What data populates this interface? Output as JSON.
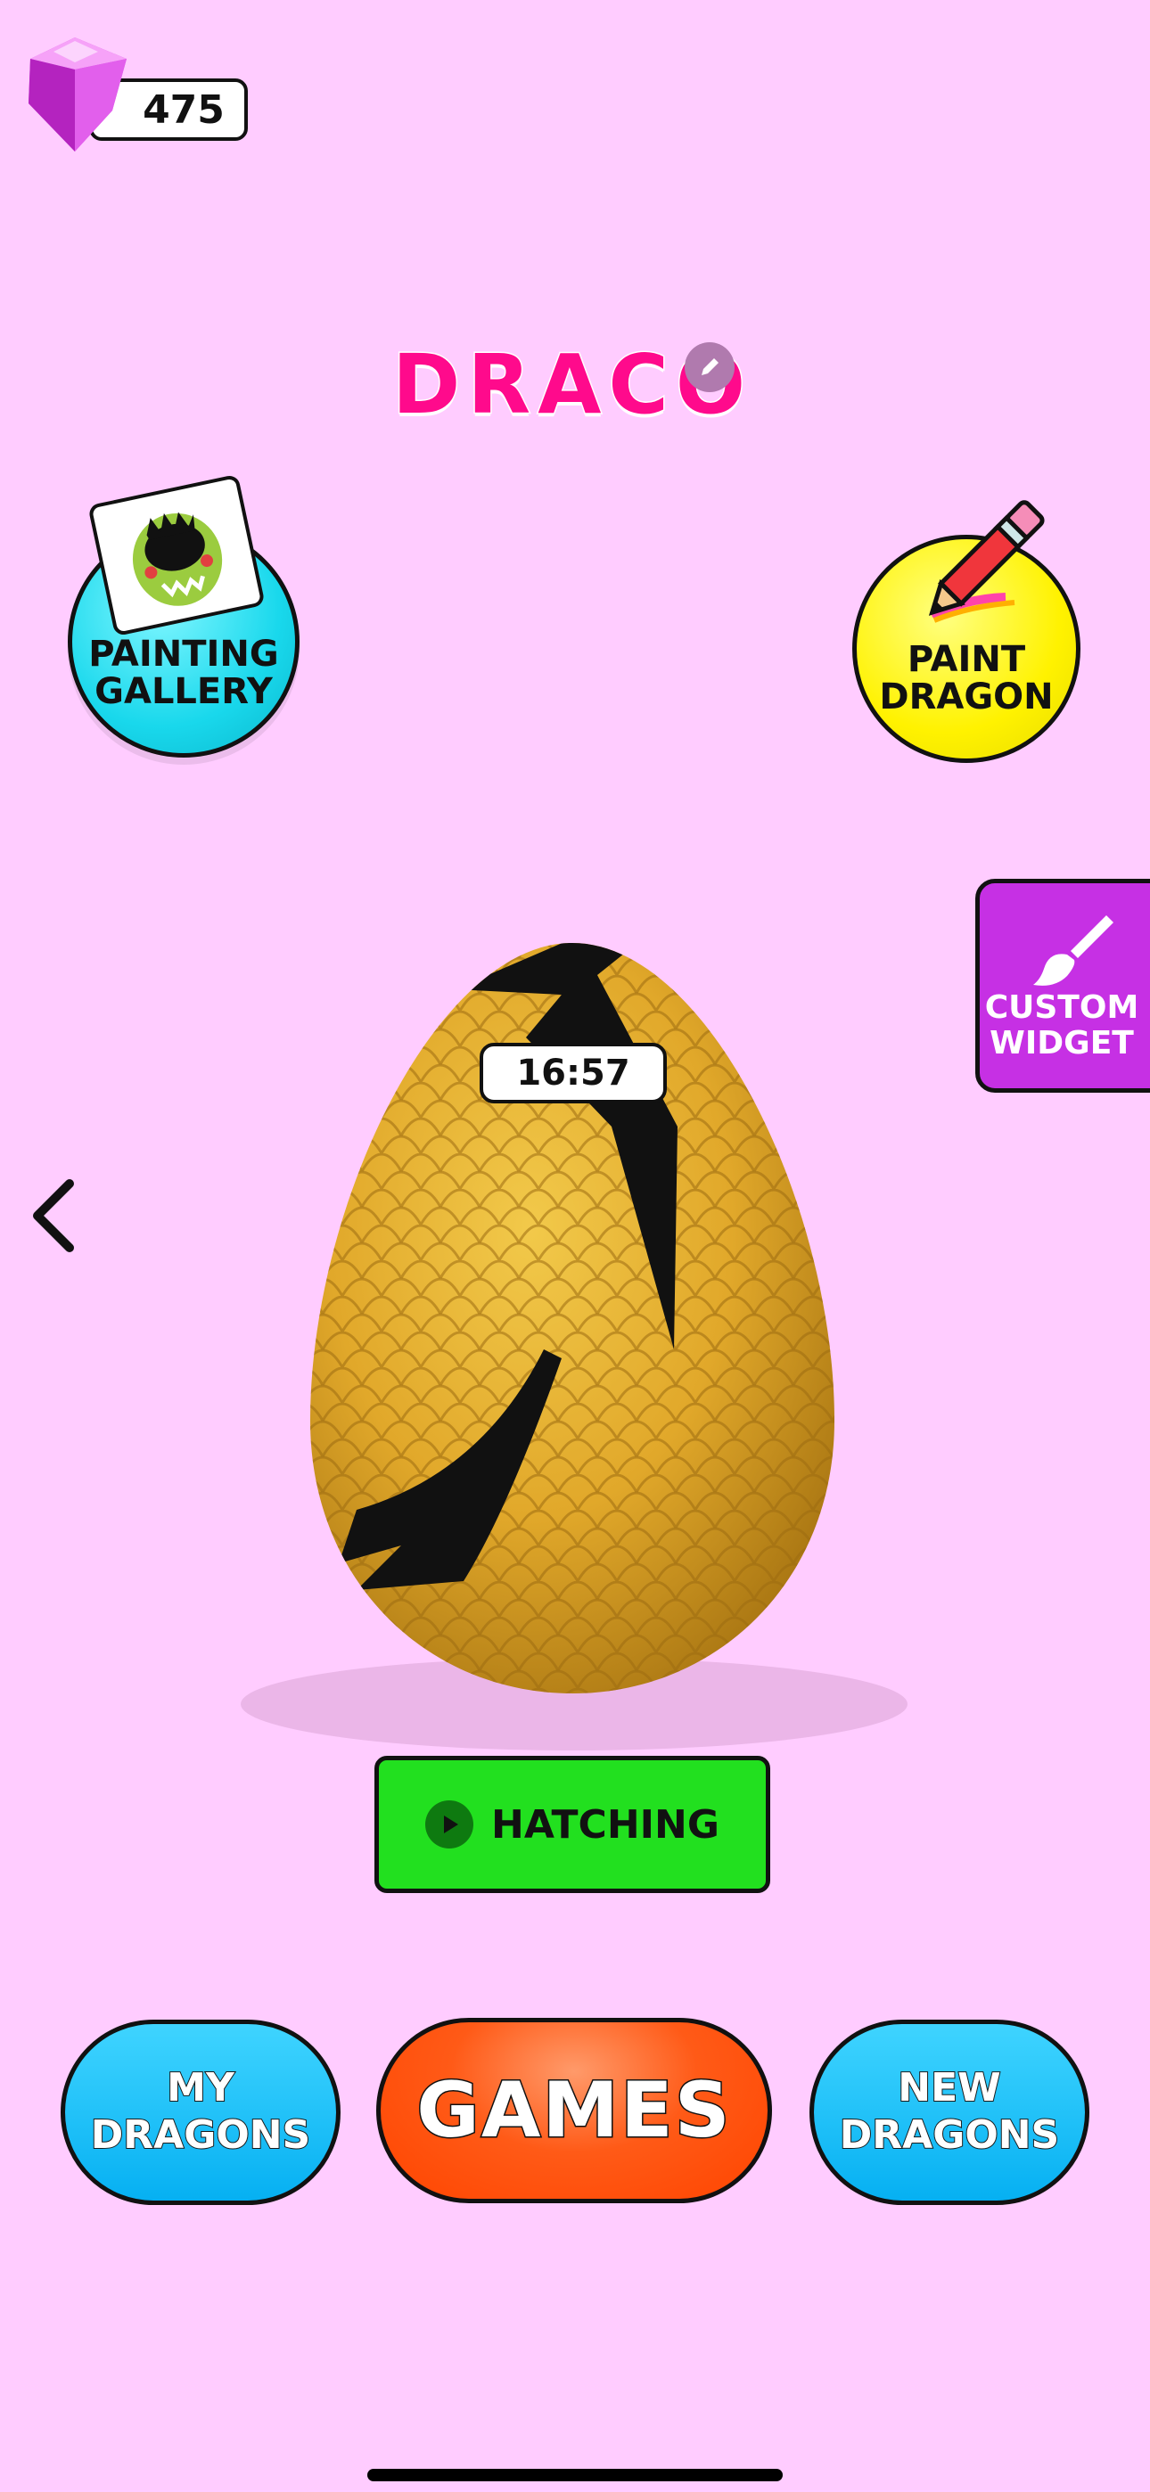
{
  "currency": {
    "gems": "475",
    "icon": "gem-icon",
    "color": "#E23BE8"
  },
  "dragon": {
    "name": "DRACO",
    "edit_icon": "pencil-icon"
  },
  "buttons": {
    "painting_gallery": {
      "line1": "PAINTING",
      "line2": "GALLERY"
    },
    "paint_dragon": {
      "line1": "PAINT",
      "line2": "DRAGON"
    },
    "custom_widget": {
      "line1": "CUSTOM",
      "line2": "WIDGET"
    },
    "hatching": "HATCHING",
    "my_dragons": {
      "line1": "MY",
      "line2": "DRAGONS"
    },
    "games": "GAMES",
    "new_dragons": {
      "line1": "NEW",
      "line2": "DRAGONS"
    }
  },
  "egg": {
    "timer": "16:57",
    "color": "#E3B02A"
  },
  "colors": {
    "background": "#FFCCFF",
    "accent_pink": "#FF0A8C",
    "hatch_green": "#22E01F",
    "games_orange": "#FF5A17",
    "pill_blue": "#06B0F2"
  }
}
